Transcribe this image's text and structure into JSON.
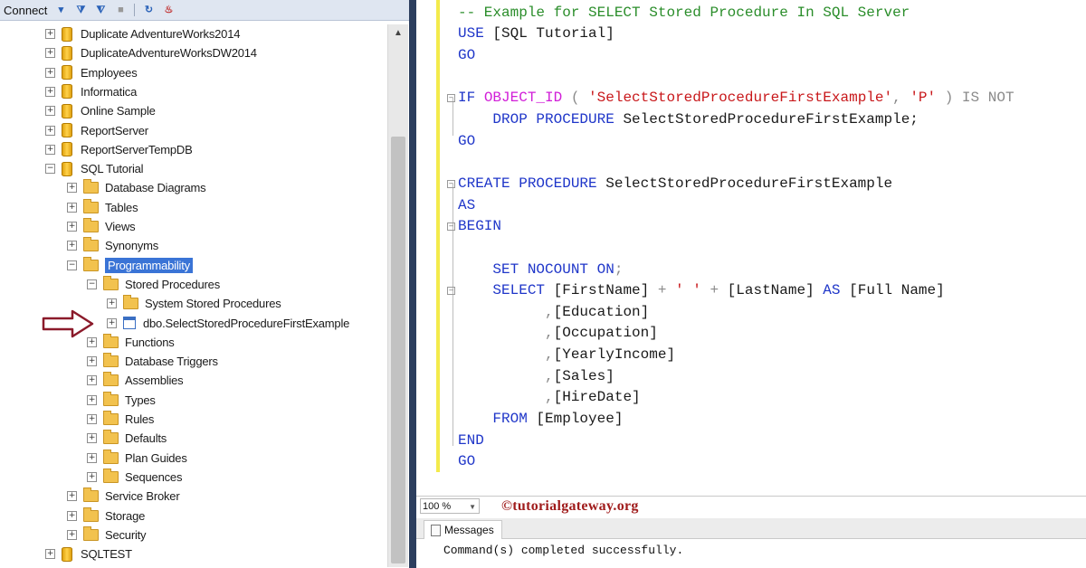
{
  "toolbar": {
    "connect_label": "Connect",
    "icons": [
      "connect-dropdown-icon",
      "filter-icon",
      "filter-settings-icon",
      "stop-icon",
      "refresh-icon",
      "activity-monitor-icon"
    ]
  },
  "tree": {
    "nodes": [
      {
        "label": "Duplicate AdventureWorks2014",
        "icon": "database-icon",
        "expander": "+"
      },
      {
        "label": "DuplicateAdventureWorksDW2014",
        "icon": "database-icon",
        "expander": "+"
      },
      {
        "label": "Employees",
        "icon": "database-icon",
        "expander": "+"
      },
      {
        "label": "Informatica",
        "icon": "database-icon",
        "expander": "+"
      },
      {
        "label": "Online Sample",
        "icon": "database-icon",
        "expander": "+"
      },
      {
        "label": "ReportServer",
        "icon": "database-icon",
        "expander": "+"
      },
      {
        "label": "ReportServerTempDB",
        "icon": "database-icon",
        "expander": "+"
      },
      {
        "label": "SQL Tutorial",
        "icon": "database-icon",
        "expander": "−"
      },
      {
        "label": "Database Diagrams",
        "icon": "folder-icon",
        "expander": "+"
      },
      {
        "label": "Tables",
        "icon": "folder-icon",
        "expander": "+"
      },
      {
        "label": "Views",
        "icon": "folder-icon",
        "expander": "+"
      },
      {
        "label": "Synonyms",
        "icon": "folder-icon",
        "expander": "+"
      },
      {
        "label": "Programmability",
        "icon": "folder-icon",
        "expander": "−",
        "selected": true
      },
      {
        "label": "Stored Procedures",
        "icon": "folder-icon",
        "expander": "−"
      },
      {
        "label": "System Stored Procedures",
        "icon": "folder-icon",
        "expander": "+"
      },
      {
        "label": "dbo.SelectStoredProcedureFirstExample",
        "icon": "stored-procedure-icon",
        "expander": "+"
      },
      {
        "label": "Functions",
        "icon": "folder-icon",
        "expander": "+"
      },
      {
        "label": "Database Triggers",
        "icon": "folder-icon",
        "expander": "+"
      },
      {
        "label": "Assemblies",
        "icon": "folder-icon",
        "expander": "+"
      },
      {
        "label": "Types",
        "icon": "folder-icon",
        "expander": "+"
      },
      {
        "label": "Rules",
        "icon": "folder-icon",
        "expander": "+"
      },
      {
        "label": "Defaults",
        "icon": "folder-icon",
        "expander": "+"
      },
      {
        "label": "Plan Guides",
        "icon": "folder-icon",
        "expander": "+"
      },
      {
        "label": "Sequences",
        "icon": "folder-icon",
        "expander": "+"
      },
      {
        "label": "Service Broker",
        "icon": "folder-icon",
        "expander": "+"
      },
      {
        "label": "Storage",
        "icon": "folder-icon",
        "expander": "+"
      },
      {
        "label": "Security",
        "icon": "folder-icon",
        "expander": "+"
      },
      {
        "label": "SQLTEST",
        "icon": "database-icon",
        "expander": "+"
      }
    ]
  },
  "editor": {
    "lines": [
      [
        {
          "t": "-- Example for SELECT Stored Procedure In SQL Server",
          "c": "cm"
        }
      ],
      [
        {
          "t": "USE ",
          "c": "kw"
        },
        {
          "t": "[SQL Tutorial]",
          "c": ""
        }
      ],
      [
        {
          "t": "GO",
          "c": "kw"
        }
      ],
      [],
      [
        {
          "t": "IF ",
          "c": "kw"
        },
        {
          "t": "OBJECT_ID",
          "c": "fn"
        },
        {
          "t": " ( ",
          "c": "gr"
        },
        {
          "t": "'SelectStoredProcedureFirstExample'",
          "c": "str"
        },
        {
          "t": ", ",
          "c": "gr"
        },
        {
          "t": "'P'",
          "c": "str"
        },
        {
          "t": " ) IS NOT",
          "c": "gr"
        }
      ],
      [
        {
          "t": "    DROP PROCEDURE ",
          "c": "kw"
        },
        {
          "t": "SelectStoredProcedureFirstExample;",
          "c": ""
        }
      ],
      [
        {
          "t": "GO",
          "c": "kw"
        }
      ],
      [],
      [
        {
          "t": "CREATE PROCEDURE ",
          "c": "kw"
        },
        {
          "t": "SelectStoredProcedureFirstExample",
          "c": ""
        }
      ],
      [
        {
          "t": "AS",
          "c": "kw"
        }
      ],
      [
        {
          "t": "BEGIN",
          "c": "kw"
        }
      ],
      [],
      [
        {
          "t": "    SET NOCOUNT ON",
          "c": "kw"
        },
        {
          "t": ";",
          "c": "gr"
        }
      ],
      [
        {
          "t": "    SELECT ",
          "c": "kw"
        },
        {
          "t": "[FirstName] ",
          "c": ""
        },
        {
          "t": "+ ",
          "c": "gr"
        },
        {
          "t": "' '",
          "c": "str"
        },
        {
          "t": " + ",
          "c": "gr"
        },
        {
          "t": "[LastName] ",
          "c": ""
        },
        {
          "t": "AS ",
          "c": "kw"
        },
        {
          "t": "[Full Name]",
          "c": ""
        }
      ],
      [
        {
          "t": "          ,",
          "c": "gr"
        },
        {
          "t": "[Education]",
          "c": ""
        }
      ],
      [
        {
          "t": "          ,",
          "c": "gr"
        },
        {
          "t": "[Occupation]",
          "c": ""
        }
      ],
      [
        {
          "t": "          ,",
          "c": "gr"
        },
        {
          "t": "[YearlyIncome]",
          "c": ""
        }
      ],
      [
        {
          "t": "          ,",
          "c": "gr"
        },
        {
          "t": "[Sales]",
          "c": ""
        }
      ],
      [
        {
          "t": "          ,",
          "c": "gr"
        },
        {
          "t": "[HireDate]",
          "c": ""
        }
      ],
      [
        {
          "t": "    FROM ",
          "c": "kw"
        },
        {
          "t": "[Employee]",
          "c": ""
        }
      ],
      [
        {
          "t": "END",
          "c": "kw"
        }
      ],
      [
        {
          "t": "GO",
          "c": "kw"
        }
      ]
    ]
  },
  "status": {
    "zoom": "100 %",
    "watermark": "©tutorialgateway.org"
  },
  "messages": {
    "tab_label": "Messages",
    "text": "Command(s) completed successfully."
  },
  "colors": {
    "keyword": "#1f36c9",
    "string": "#c8171a",
    "function": "#d11ed8",
    "comment": "#2a8d2a",
    "selection": "#3a74d6",
    "annotation_arrow": "#8b1a2a"
  }
}
